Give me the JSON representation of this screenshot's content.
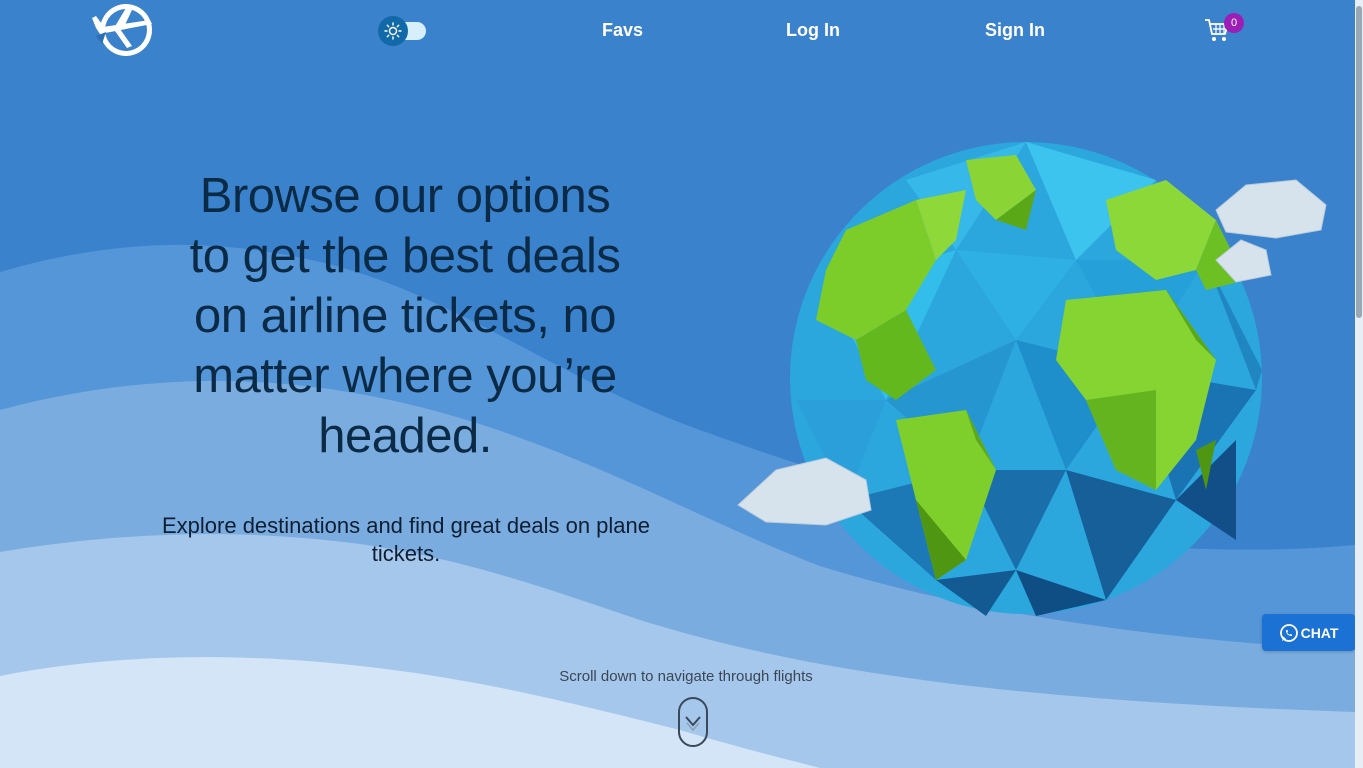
{
  "colors": {
    "background": "#3a82cc",
    "heading": "#0b2a46",
    "nav_text": "#ffffff",
    "cart_badge": "#9b1fb4",
    "chat_button": "#1b72d4",
    "toggle_knob": "#1269a8"
  },
  "nav": {
    "logo_icon": "airplane-logo-icon",
    "theme_toggle_icon": "sun-icon",
    "links": {
      "favs": "Favs",
      "login": "Log In",
      "signin": "Sign In"
    },
    "cart": {
      "icon": "shopping-cart-icon",
      "count": "0"
    }
  },
  "hero": {
    "title_lines": [
      "Browse our options",
      "to get the best deals",
      "on airline tickets, no",
      "matter where you’re",
      "headed."
    ],
    "subtitle": "Explore destinations and find great deals on plane tickets."
  },
  "scroll": {
    "hint": "Scroll down to navigate through flights",
    "icon": "chevron-down-icon"
  },
  "chat": {
    "label": "CHAT",
    "icon": "whatsapp-icon"
  }
}
